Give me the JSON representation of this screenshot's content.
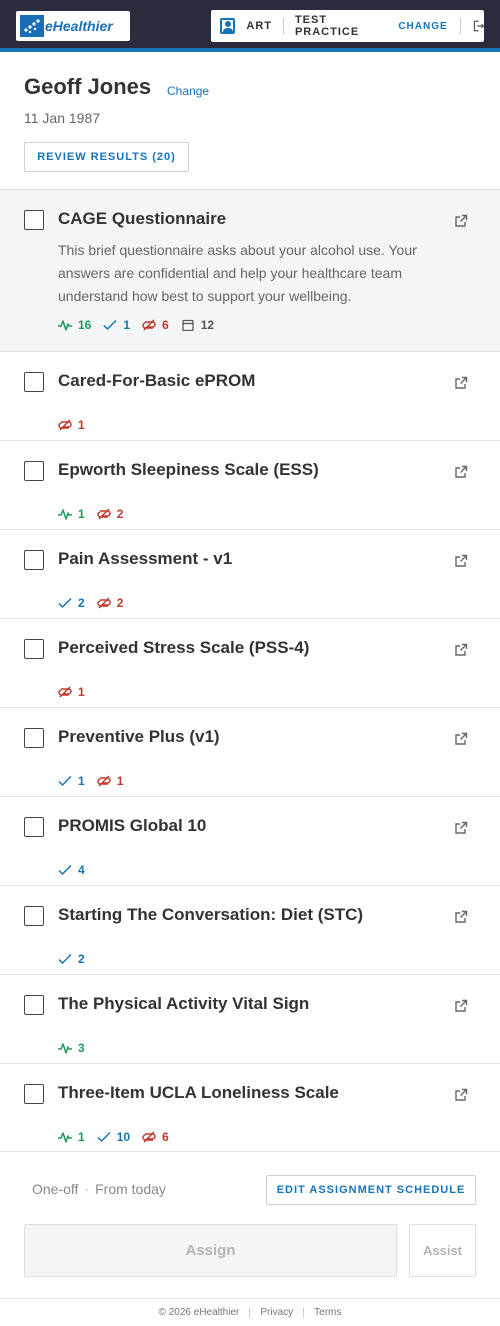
{
  "brand": {
    "name": "eHealthier"
  },
  "context": {
    "user_label": "ART",
    "practice_label": "TEST PRACTICE",
    "change_label": "CHANGE"
  },
  "patient": {
    "name": "Geoff Jones",
    "change_label": "Change",
    "dob": "11 Jan 1987",
    "review_label": "REVIEW RESULTS (20)"
  },
  "items": [
    {
      "title": "CAGE Questionnaire",
      "description": "This brief questionnaire asks about your alcohol use. Your answers are confidential and help your healthcare team understand how best to support your wellbeing.",
      "stats": [
        {
          "icon": "activity-icon",
          "color": "green",
          "value": "16"
        },
        {
          "icon": "check-icon",
          "color": "blue",
          "value": "1"
        },
        {
          "icon": "skip-icon",
          "color": "red",
          "value": "6"
        },
        {
          "icon": "calendar-icon",
          "color": "grey",
          "value": "12"
        }
      ]
    },
    {
      "title": "Cared-For-Basic ePROM",
      "stats": [
        {
          "icon": "skip-icon",
          "color": "red",
          "value": "1"
        }
      ]
    },
    {
      "title": "Epworth Sleepiness Scale (ESS)",
      "stats": [
        {
          "icon": "activity-icon",
          "color": "green",
          "value": "1"
        },
        {
          "icon": "skip-icon",
          "color": "red",
          "value": "2"
        }
      ]
    },
    {
      "title": "Pain Assessment - v1",
      "stats": [
        {
          "icon": "check-icon",
          "color": "blue",
          "value": "2"
        },
        {
          "icon": "skip-icon",
          "color": "red",
          "value": "2"
        }
      ]
    },
    {
      "title": "Perceived Stress Scale (PSS-4)",
      "stats": [
        {
          "icon": "skip-icon",
          "color": "red",
          "value": "1"
        }
      ]
    },
    {
      "title": "Preventive Plus (v1)",
      "stats": [
        {
          "icon": "check-icon",
          "color": "blue",
          "value": "1"
        },
        {
          "icon": "skip-icon",
          "color": "red",
          "value": "1"
        }
      ]
    },
    {
      "title": "PROMIS Global 10",
      "stats": [
        {
          "icon": "check-icon",
          "color": "blue",
          "value": "4"
        }
      ]
    },
    {
      "title": "Starting The Conversation: Diet (STC)",
      "stats": [
        {
          "icon": "check-icon",
          "color": "blue",
          "value": "2"
        }
      ]
    },
    {
      "title": "The Physical Activity Vital Sign",
      "stats": [
        {
          "icon": "activity-icon",
          "color": "green",
          "value": "3"
        }
      ]
    },
    {
      "title": "Three-Item UCLA Loneliness Scale",
      "stats": [
        {
          "icon": "activity-icon",
          "color": "green",
          "value": "1"
        },
        {
          "icon": "check-icon",
          "color": "blue",
          "value": "10"
        },
        {
          "icon": "skip-icon",
          "color": "red",
          "value": "6"
        }
      ]
    }
  ],
  "schedule": {
    "frequency": "One-off",
    "start": "From today",
    "edit_label": "EDIT ASSIGNMENT SCHEDULE"
  },
  "actions": {
    "assign_label": "Assign",
    "assist_label": "Assist"
  },
  "footer": {
    "copyright": "© 2026 eHealthier",
    "privacy": "Privacy",
    "terms": "Terms"
  },
  "colors": {
    "header_bg": "#2a2b3d",
    "accent": "#1573b8",
    "green": "#1f9a5a",
    "red": "#c0392b"
  }
}
